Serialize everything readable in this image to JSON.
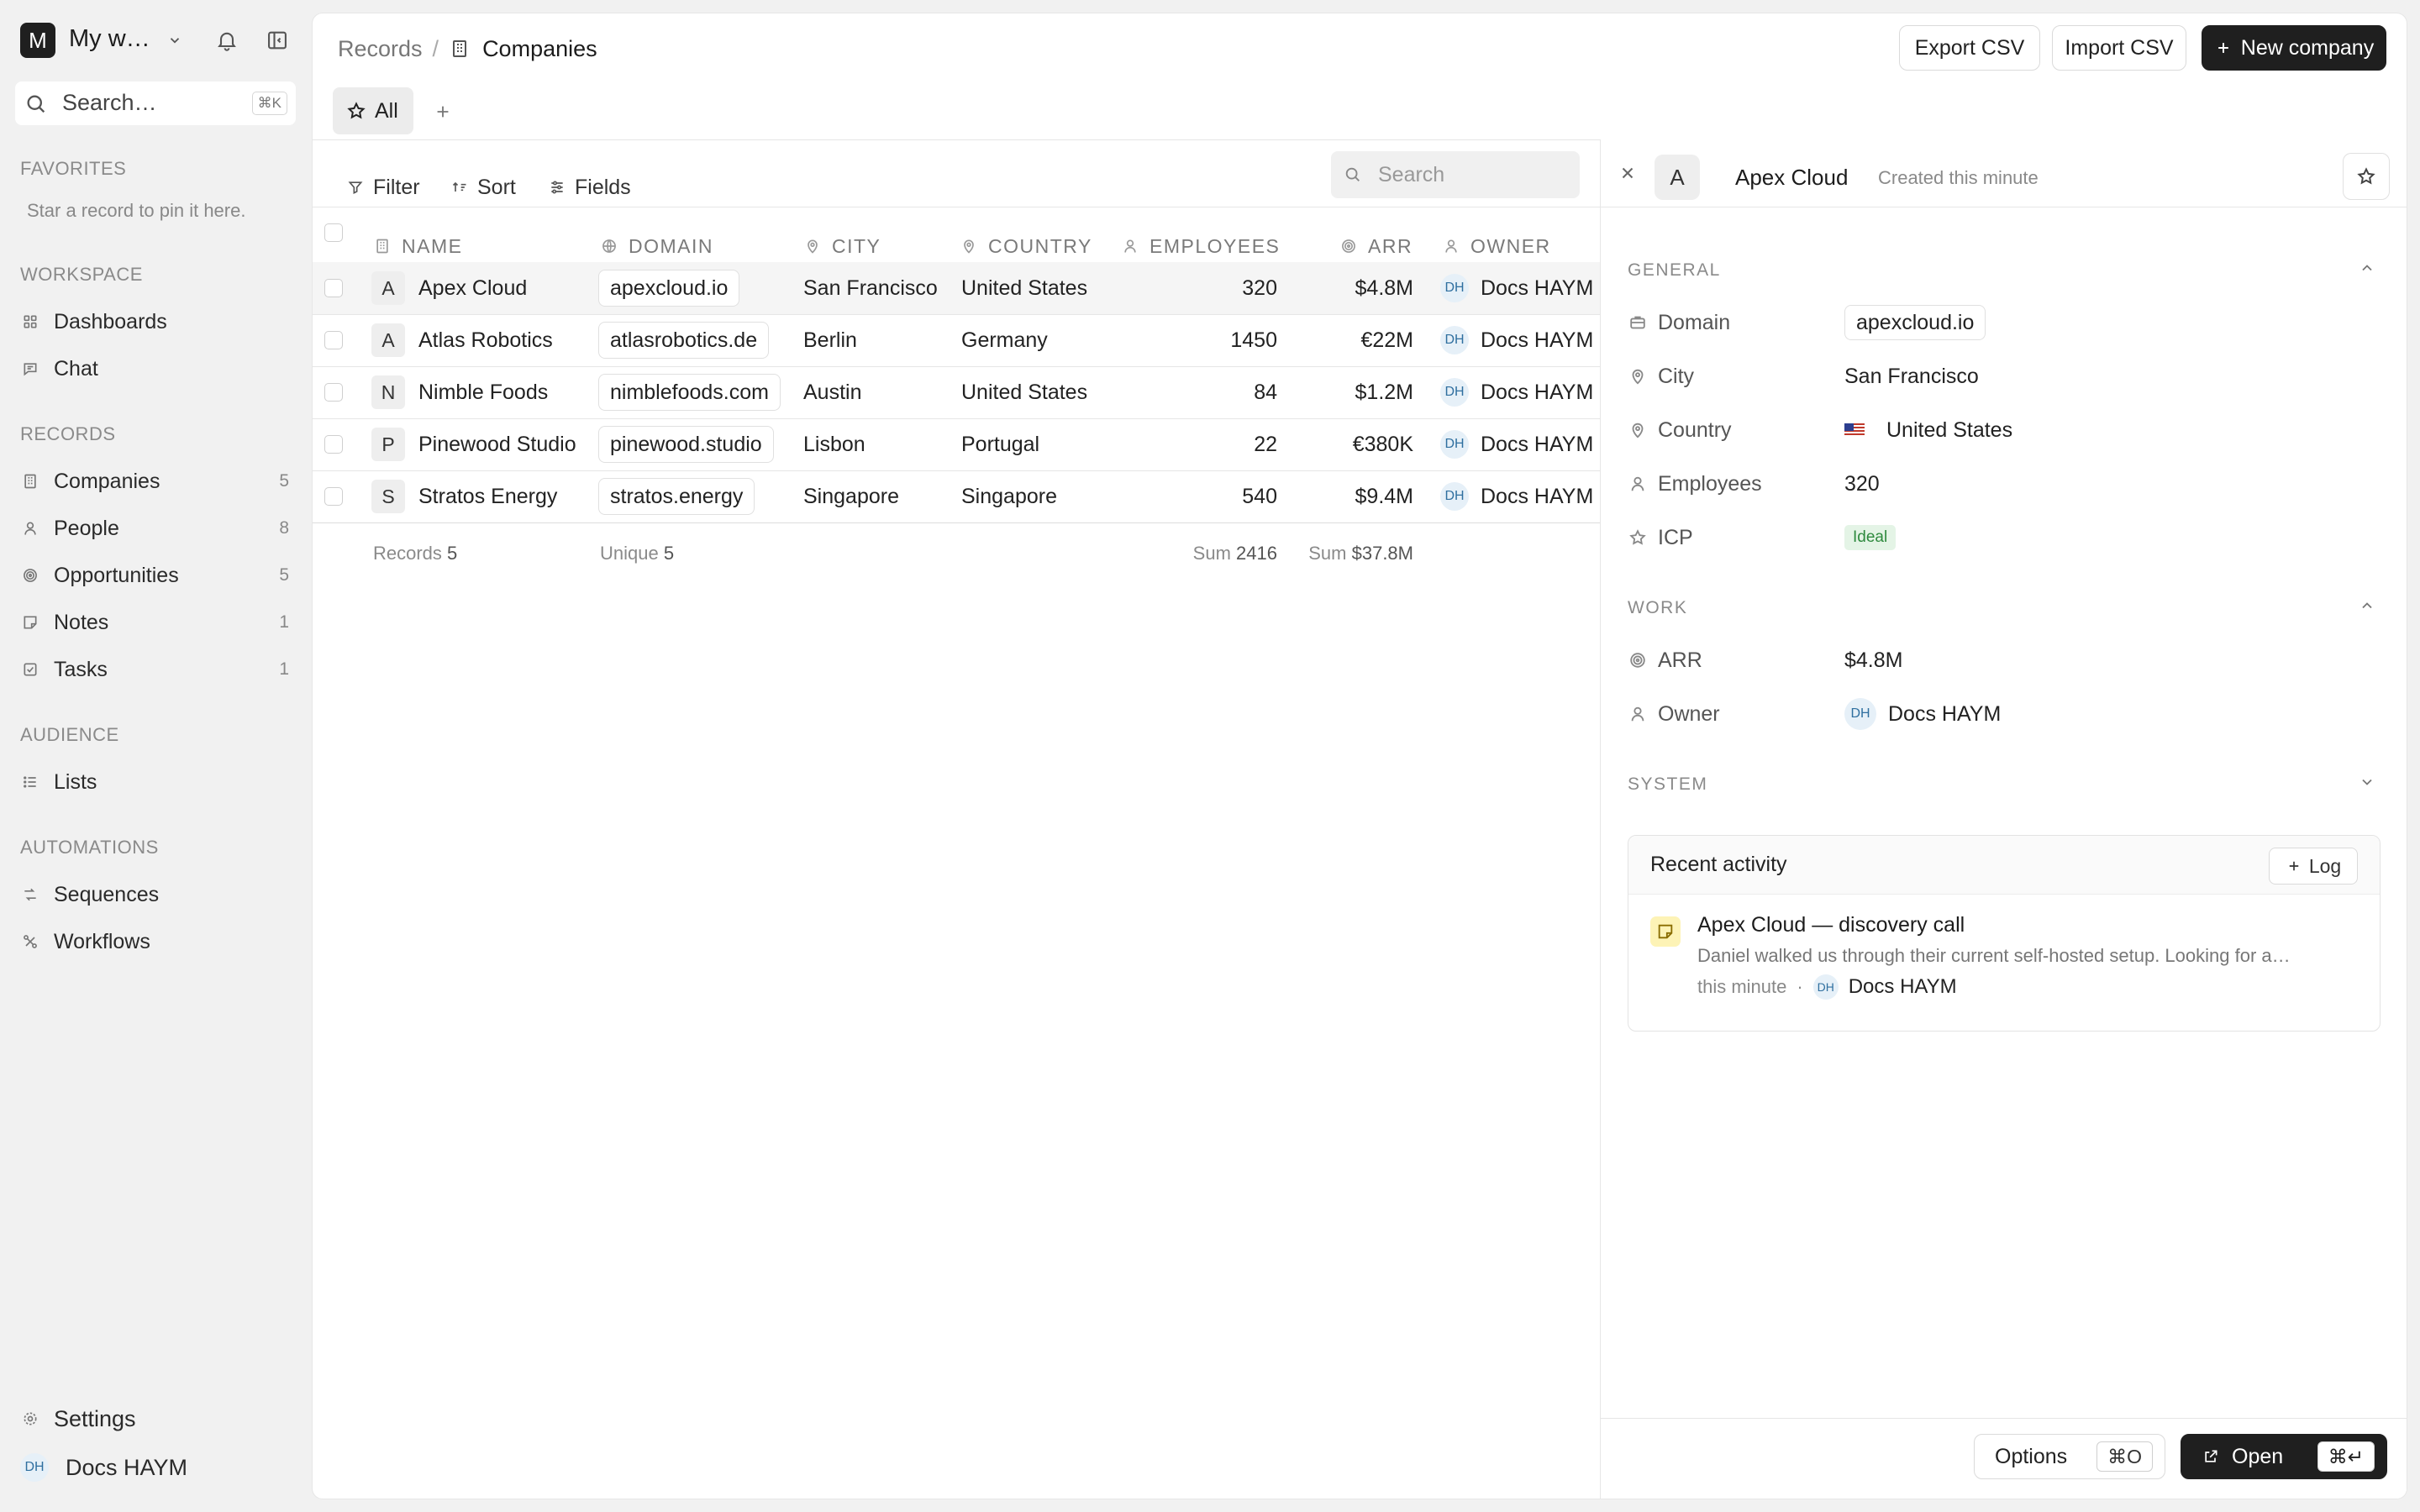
{
  "sidebar": {
    "workspace_initial": "M",
    "workspace_name": "My w…",
    "search_placeholder": "Search…",
    "search_shortcut": "⌘K",
    "favorites_title": "FAVORITES",
    "favorites_hint": "Star a record to pin it here.",
    "workspace_title": "WORKSPACE",
    "workspace_items": [
      {
        "label": "Dashboards",
        "icon": "dashboard-icon"
      },
      {
        "label": "Chat",
        "icon": "chat-icon"
      }
    ],
    "records_title": "RECORDS",
    "records_items": [
      {
        "label": "Companies",
        "count": "5",
        "icon": "building-icon"
      },
      {
        "label": "People",
        "count": "8",
        "icon": "person-icon"
      },
      {
        "label": "Opportunities",
        "count": "5",
        "icon": "target-icon"
      },
      {
        "label": "Notes",
        "count": "1",
        "icon": "note-icon"
      },
      {
        "label": "Tasks",
        "count": "1",
        "icon": "checkbox-icon"
      }
    ],
    "audience_title": "AUDIENCE",
    "audience_items": [
      {
        "label": "Lists",
        "icon": "list-icon"
      }
    ],
    "automations_title": "AUTOMATIONS",
    "automations_items": [
      {
        "label": "Sequences",
        "icon": "sequence-icon"
      },
      {
        "label": "Workflows",
        "icon": "workflow-icon"
      }
    ],
    "settings_label": "Settings",
    "user_initials": "DH",
    "user_name": "Docs HAYM"
  },
  "header": {
    "breadcrumb_root": "Records",
    "breadcrumb_separator": "/",
    "breadcrumb_current": "Companies",
    "export_label": "Export CSV",
    "import_label": "Import CSV",
    "new_label": "New company"
  },
  "views": {
    "active_tab": "All"
  },
  "toolbar": {
    "filter_label": "Filter",
    "sort_label": "Sort",
    "fields_label": "Fields",
    "search_placeholder": "Search"
  },
  "table": {
    "columns": [
      "NAME",
      "DOMAIN",
      "CITY",
      "COUNTRY",
      "EMPLOYEES",
      "ARR",
      "OWNER"
    ],
    "rows": [
      {
        "initial": "A",
        "name": "Apex Cloud",
        "domain": "apexcloud.io",
        "city": "San Francisco",
        "country": "United States",
        "employees": "320",
        "arr": "$4.8M",
        "owner_initials": "DH",
        "owner": "Docs HAYM"
      },
      {
        "initial": "A",
        "name": "Atlas Robotics",
        "domain": "atlasrobotics.de",
        "city": "Berlin",
        "country": "Germany",
        "employees": "1450",
        "arr": "€22M",
        "owner_initials": "DH",
        "owner": "Docs HAYM"
      },
      {
        "initial": "N",
        "name": "Nimble Foods",
        "domain": "nimblefoods.com",
        "city": "Austin",
        "country": "United States",
        "employees": "84",
        "arr": "$1.2M",
        "owner_initials": "DH",
        "owner": "Docs HAYM"
      },
      {
        "initial": "P",
        "name": "Pinewood Studio",
        "domain": "pinewood.studio",
        "city": "Lisbon",
        "country": "Portugal",
        "employees": "22",
        "arr": "€380K",
        "owner_initials": "DH",
        "owner": "Docs HAYM"
      },
      {
        "initial": "S",
        "name": "Stratos Energy",
        "domain": "stratos.energy",
        "city": "Singapore",
        "country": "Singapore",
        "employees": "540",
        "arr": "$9.4M",
        "owner_initials": "DH",
        "owner": "Docs HAYM"
      }
    ],
    "footer": {
      "records_label": "Records",
      "records_value": "5",
      "unique_label": "Unique",
      "unique_value": "5",
      "emp_sum_label": "Sum",
      "emp_sum_value": "2416",
      "arr_sum_label": "Sum",
      "arr_sum_value": "$37.8M"
    }
  },
  "detail": {
    "initial": "A",
    "title": "Apex Cloud",
    "subtitle": "Created this minute",
    "general_title": "GENERAL",
    "fields": {
      "domain_label": "Domain",
      "domain_value": "apexcloud.io",
      "city_label": "City",
      "city_value": "San Francisco",
      "country_label": "Country",
      "country_flag": "🇺🇸",
      "country_value": "United States",
      "employees_label": "Employees",
      "employees_value": "320",
      "icp_label": "ICP",
      "icp_value": "Ideal"
    },
    "work_title": "WORK",
    "work": {
      "arr_label": "ARR",
      "arr_value": "$4.8M",
      "owner_label": "Owner",
      "owner_initials": "DH",
      "owner_value": "Docs HAYM"
    },
    "system_title": "SYSTEM",
    "activity": {
      "title": "Recent activity",
      "log_label": "Log",
      "item_title": "Apex Cloud — discovery call",
      "item_body": "Daniel walked us through their current self-hosted setup. Looking for a…",
      "item_time": "this minute",
      "item_dot": "·",
      "item_owner_initials": "DH",
      "item_owner": "Docs HAYM"
    },
    "options_label": "Options",
    "options_shortcut": "⌘O",
    "open_label": "Open",
    "open_shortcut": "⌘↵"
  },
  "colors": {
    "accent_dark": "#1f1f1f",
    "ideal_green": "#2e8a3e",
    "owner_blue": "#2f6f9f"
  }
}
